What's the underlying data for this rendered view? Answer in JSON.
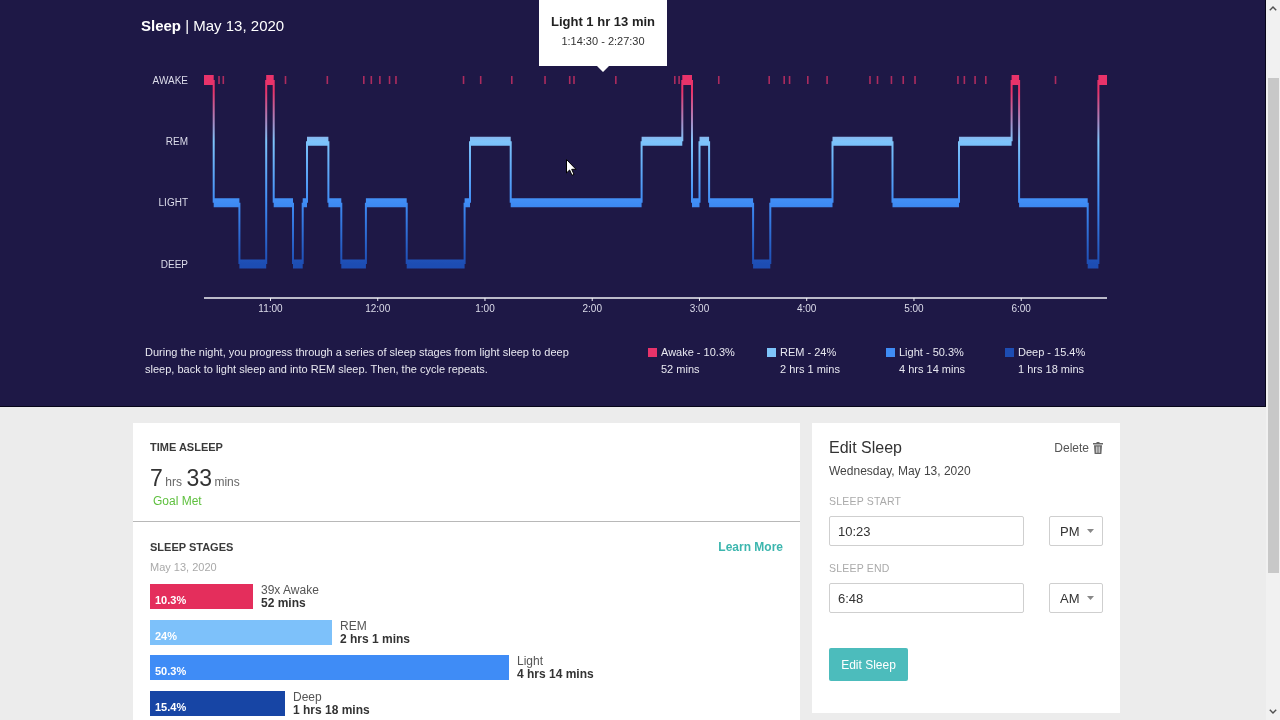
{
  "header": {
    "title": "**Sleep** | May 13, 2020"
  },
  "chart": {
    "tooltip": {
      "title": "Light 1 hr 13 min",
      "time": "1:14:30 - 2:27:30"
    },
    "y_labels": [
      "AWAKE",
      "REM",
      "LIGHT",
      "DEEP"
    ],
    "x_labels": [
      "11:00",
      "12:00",
      "1:00",
      "2:00",
      "3:00",
      "4:00",
      "5:00",
      "6:00"
    ]
  },
  "description": "During the night, you progress through a series of sleep stages from light sleep to deep sleep, back to light sleep and into REM sleep. Then, the cycle repeats.",
  "legend": [
    {
      "label": "Awake - 10.3%",
      "duration": "52 mins",
      "color": "#e8336a"
    },
    {
      "label": "REM - 24%",
      "duration": "2 hrs 1 mins",
      "color": "#7ec4fb"
    },
    {
      "label": "Light - 50.3%",
      "duration": "4 hrs 14 mins",
      "color": "#3f8cf5"
    },
    {
      "label": "Deep - 15.4%",
      "duration": "1 hrs 18 mins",
      "color": "#1d4db3"
    }
  ],
  "time_asleep": {
    "label": "TIME ASLEEP",
    "parts": [
      {
        "number": "7",
        "unit": "hrs"
      },
      {
        "number": "33",
        "unit": "mins"
      }
    ],
    "status": "Goal Met"
  },
  "sleep_stages": {
    "title": "SLEEP STAGES",
    "link": "Learn More",
    "date": "May 13, 2020",
    "rows": [
      {
        "percent": "10.3%",
        "label": "39x Awake",
        "duration": "52 mins",
        "color": "#e42e5c"
      },
      {
        "percent": "24%",
        "label": "REM",
        "duration": "2 hrs 1 mins",
        "color": "#7dc1fa"
      },
      {
        "percent": "50.3%",
        "label": "Light",
        "duration": "4 hrs 14 mins",
        "color": "#3f8cf6"
      },
      {
        "percent": "15.4%",
        "label": "Deep",
        "duration": "1 hrs 18 mins",
        "color": "#1745a5"
      }
    ]
  },
  "edit_sleep": {
    "title": "Edit Sleep",
    "delete": "Delete",
    "date": "Wednesday, May 13, 2020",
    "fields": [
      {
        "label": "SLEEP START",
        "value": "10:23",
        "period": "PM"
      },
      {
        "label": "SLEEP END",
        "value": "6:48",
        "period": "AM"
      }
    ],
    "submit": "Edit Sleep"
  }
}
